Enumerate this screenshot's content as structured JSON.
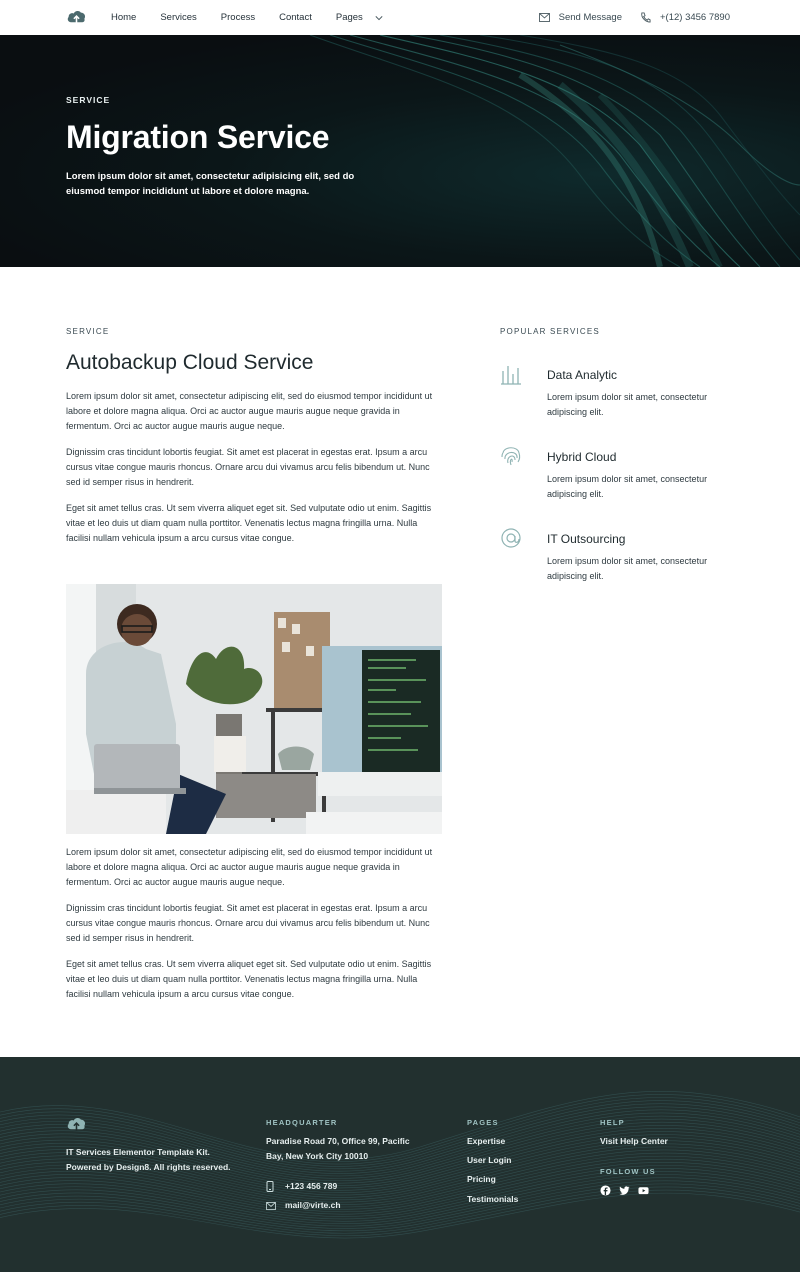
{
  "nav": {
    "logo_icon": "cloud-upload-icon",
    "items": [
      {
        "label": "Home"
      },
      {
        "label": "Services"
      },
      {
        "label": "Process"
      },
      {
        "label": "Contact"
      },
      {
        "label": "Pages"
      }
    ],
    "send_message": "Send Message",
    "phone": "+(12) 3456 7890"
  },
  "hero": {
    "eyebrow": "SERVICE",
    "title": "Migration Service",
    "description": "Lorem ipsum dolor sit amet, consectetur adipisicing elit, sed do eiusmod tempor incididunt ut labore et dolore magna."
  },
  "main": {
    "eyebrow": "SERVICE",
    "title": "Autobackup Cloud Service",
    "paragraphs_top": [
      "Lorem ipsum dolor sit amet, consectetur adipiscing elit, sed do eiusmod tempor incididunt ut labore et dolore magna aliqua. Orci ac auctor augue mauris augue neque gravida in fermentum. Orci ac auctor augue mauris augue neque.",
      "Dignissim cras tincidunt lobortis feugiat. Sit amet est placerat in egestas erat. Ipsum a arcu cursus vitae congue mauris rhoncus. Ornare arcu dui vivamus arcu felis bibendum ut. Nunc sed id semper risus in hendrerit.",
      "Eget sit amet tellus cras. Ut sem viverra aliquet eget sit. Sed vulputate odio ut enim. Sagittis vitae et leo duis ut diam quam nulla porttitor. Venenatis lectus magna fringilla urna. Nulla facilisi nullam vehicula ipsum a arcu cursus vitae congue."
    ],
    "paragraphs_bottom": [
      "Lorem ipsum dolor sit amet, consectetur adipiscing elit, sed do eiusmod tempor incididunt ut labore et dolore magna aliqua. Orci ac auctor augue mauris augue neque gravida in fermentum. Orci ac auctor augue mauris augue neque.",
      "Dignissim cras tincidunt lobortis feugiat. Sit amet est placerat in egestas erat. Ipsum a arcu cursus vitae congue mauris rhoncus. Ornare arcu dui vivamus arcu felis bibendum ut. Nunc sed id semper risus in hendrerit.",
      "Eget sit amet tellus cras. Ut sem viverra aliquet eget sit. Sed vulputate odio ut enim. Sagittis vitae et leo duis ut diam quam nulla porttitor. Venenatis lectus magna fringilla urna. Nulla facilisi nullam vehicula ipsum a arcu cursus vitae congue."
    ]
  },
  "sidebar": {
    "eyebrow": "POPULAR SERVICES",
    "services": [
      {
        "icon": "bar-chart-icon",
        "title": "Data Analytic",
        "desc": "Lorem ipsum dolor sit amet, consectetur adipiscing elit."
      },
      {
        "icon": "fingerprint-icon",
        "title": "Hybrid Cloud",
        "desc": "Lorem ipsum dolor sit amet, consectetur adipiscing elit."
      },
      {
        "icon": "at-sign-icon",
        "title": "IT Outsourcing",
        "desc": "Lorem ipsum dolor sit amet, consectetur adipiscing elit."
      }
    ]
  },
  "footer": {
    "about": "IT Services Elementor Template Kit. Powered by Design8. All rights reserved.",
    "headquarter": {
      "heading": "HEADQUARTER",
      "address": "Paradise Road 70, Office 99, Pacific Bay,  New York City 10010",
      "phone": "+123 456 789",
      "email": "mail@virte.ch"
    },
    "pages": {
      "heading": "PAGES",
      "links": [
        "Expertise",
        "User Login",
        "Pricing",
        "Testimonials"
      ]
    },
    "help": {
      "heading": "HELP",
      "link": "Visit Help Center",
      "follow_heading": "FOLLOW US",
      "social_icons": [
        "facebook-icon",
        "twitter-icon",
        "youtube-icon"
      ]
    }
  },
  "colors": {
    "accent": "#8fb3b3",
    "hero_bg": "#0b1416",
    "footer_bg": "#22302f",
    "text_dark": "#1f2a2e"
  }
}
